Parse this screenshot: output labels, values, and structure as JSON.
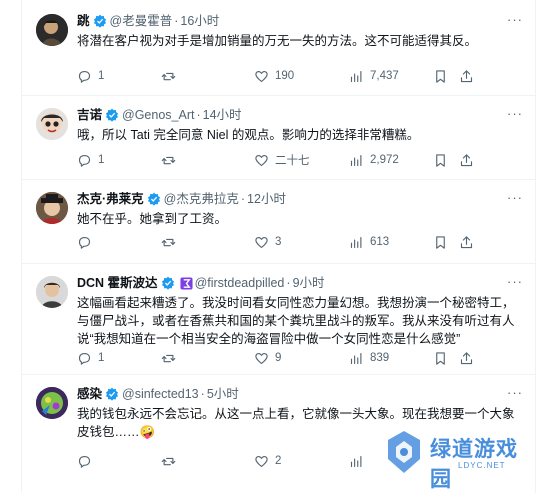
{
  "colors": {
    "accent": "#1d9bf0",
    "muted": "#536471",
    "text": "#0f1419",
    "divider": "#eff3f4",
    "watermark": "#2f7fd8"
  },
  "tweets": [
    {
      "name": "跳",
      "handle": "@老曼霍普",
      "time": "16小时",
      "text": "将潜在客户视为对手是增加销量的万无一失的方法。这不可能适得其反。",
      "replies": "1",
      "retweets": "",
      "likes": "190",
      "views": "7,437"
    },
    {
      "name": "吉诺",
      "handle": "@Genos_Art",
      "time": "14小时",
      "text": "哦，所以 Tati 完全同意 Niel 的观点。影响力的选择非常糟糕。",
      "replies": "1",
      "retweets": "",
      "likes": "二十七",
      "views": "2,972"
    },
    {
      "name": "杰克·弗莱克",
      "handle": "@杰克弗拉克",
      "time": "12小时",
      "text": "她不在乎。她拿到了工资。",
      "replies": "",
      "retweets": "",
      "likes": "3",
      "views": "613"
    },
    {
      "name": "DCN 霍斯波达",
      "handle": "@firstdeadpilled",
      "time": "9小时",
      "text": "这幅画看起来糟透了。我没时间看女同性恋力量幻想。我想扮演一个秘密特工，与僵尸战斗，或者在香蕉共和国的某个粪坑里战斗的叛军。我从来没有听过有人说“我想知道在一个相当安全的海盗冒险中做一个女同性恋是什么感觉”",
      "replies": "1",
      "retweets": "",
      "likes": "9",
      "views": "839"
    },
    {
      "name": "感染",
      "handle": "@sinfected13",
      "time": "5小时",
      "text": "我的钱包永远不会忘记。从这一点上看，它就像一头大象。现在我想要一个大象皮钱包……",
      "emoji": "🤪",
      "replies": "",
      "retweets": "",
      "likes": "2",
      "views": ""
    }
  ],
  "icons": {
    "reply": "reply-icon",
    "retweet": "retweet-icon",
    "like": "heart-icon",
    "views": "views-icon",
    "bookmark": "bookmark-icon",
    "share": "share-icon",
    "verified": "verified-badge-icon",
    "more": "more-icon"
  },
  "watermark": {
    "text": "绿道游戏园",
    "url": "LDYC.NET"
  }
}
